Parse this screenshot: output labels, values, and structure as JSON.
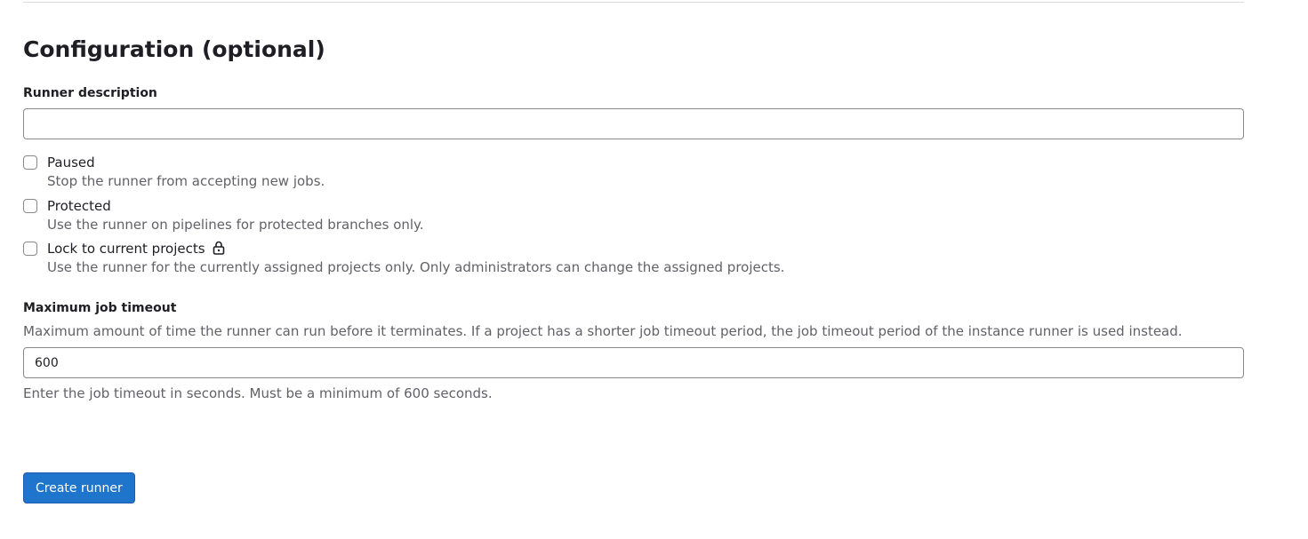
{
  "section": {
    "title": "Configuration (optional)"
  },
  "runner_description": {
    "label": "Runner description",
    "value": "",
    "placeholder": ""
  },
  "options": [
    {
      "label": "Paused",
      "help": "Stop the runner from accepting new jobs.",
      "checked": false
    },
    {
      "label": "Protected",
      "help": "Use the runner on pipelines for protected branches only.",
      "checked": false
    },
    {
      "label": "Lock to current projects",
      "help": "Use the runner for the currently assigned projects only. Only administrators can change the assigned projects.",
      "checked": false,
      "icon": "lock-icon"
    }
  ],
  "timeout": {
    "label": "Maximum job timeout",
    "description": "Maximum amount of time the runner can run before it terminates. If a project has a shorter job timeout period, the job timeout period of the instance runner is used instead.",
    "value": "600",
    "help": "Enter the job timeout in seconds. Must be a minimum of 600 seconds."
  },
  "actions": {
    "create_label": "Create runner"
  },
  "colors": {
    "primary": "#1f75cb",
    "text": "#1f1e24",
    "muted": "#626168",
    "border": "#89888d"
  }
}
